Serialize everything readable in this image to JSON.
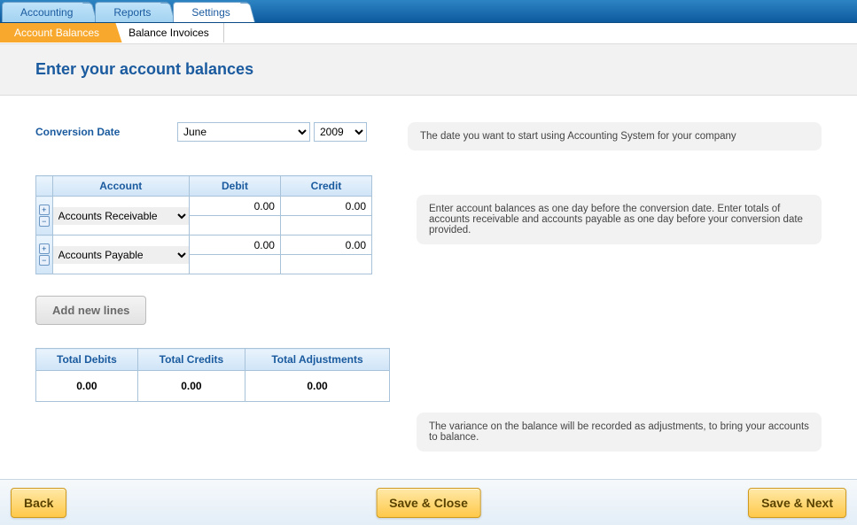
{
  "topTabs": [
    "Accounting",
    "Reports",
    "Settings"
  ],
  "subTabs": [
    "Account Balances",
    "Balance Invoices"
  ],
  "heading": "Enter your account balances",
  "conversion": {
    "label": "Conversion Date",
    "month": "June",
    "year": "2009",
    "help": "The date you want to start using Accounting System for your company"
  },
  "balanceTable": {
    "headers": {
      "account": "Account",
      "debit": "Debit",
      "credit": "Credit"
    },
    "rows": [
      {
        "account": "Accounts Receivable",
        "debit": "0.00",
        "credit": "0.00"
      },
      {
        "account": "Accounts Payable",
        "debit": "0.00",
        "credit": "0.00"
      }
    ],
    "help": "Enter account balances as one day before the conversion date. Enter totals of accounts receivable and accounts payable as one day before your conversion date provided."
  },
  "addLinesLabel": "Add new lines",
  "totals": {
    "headers": {
      "debits": "Total Debits",
      "credits": "Total Credits",
      "adjustments": "Total Adjustments"
    },
    "debits": "0.00",
    "credits": "0.00",
    "adjustments": "0.00",
    "help": "The variance on the balance will be recorded as adjustments, to bring your accounts to balance."
  },
  "buttons": {
    "back": "Back",
    "saveClose": "Save & Close",
    "saveNext": "Save & Next"
  }
}
